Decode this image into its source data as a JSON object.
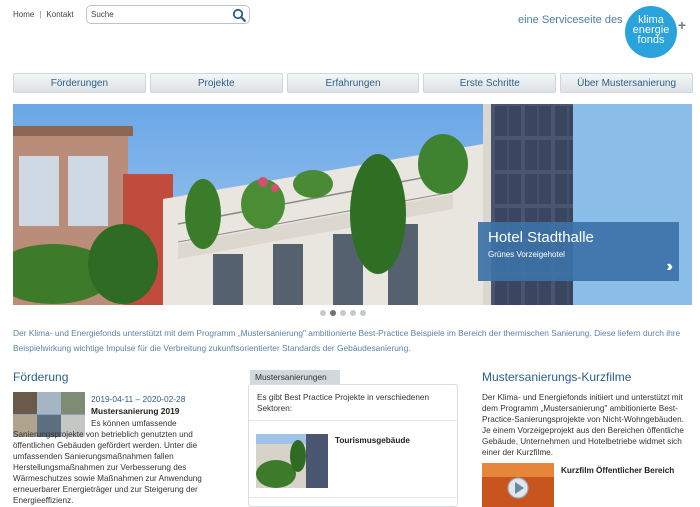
{
  "header": {
    "links": {
      "home": "Home",
      "separator": "|",
      "kontakt": "Kontakt"
    },
    "search": {
      "placeholder": "Suche"
    },
    "service_text": "eine Serviceseite des",
    "logo": {
      "line1": "klima",
      "line2": "energie",
      "line3": "fonds",
      "plus": "+"
    }
  },
  "nav": {
    "items": [
      "Förderungen",
      "Projekte",
      "Erfahrungen",
      "Erste Schritte",
      "Über Mustersanierung"
    ]
  },
  "slider": {
    "title": "Hotel Stadthalle",
    "subtitle": "Grünes Vorzeigehotel",
    "next_arrow": "››",
    "slide_count": 5,
    "active_slide": 2
  },
  "intro": "Der Klima- und Energiefonds unterstützt mit dem Programm „Mustersanierung\" ambitionierte Best-Practice Beispiele im Bereich der thermischen Sanierung. Diese liefern durch ihre Beispielwirkung wichtige Impulse für die Verbreitung zukunftsorientierter Standards der Gebäudesanierung.",
  "foerderung": {
    "heading": "Förderung",
    "date": "2019-04-11 – 2020-02-28",
    "title": "Mustersanierung 2019",
    "text": "Es können umfassende Sanierungsprojekte von betrieblich genutzten und öffentlichen Gebäuden gefördert werden. Unter die umfassenden Sanierungsmaßnahmen fallen Herstellungsmaßnahmen zur Verbesserung des Wärmeschutzes sowie Maßnahmen zur Anwendung erneuerbarer Energieträger und zur Steigerung der Energieeffizienz."
  },
  "mustersanierungen": {
    "tab": "Mustersanierungen",
    "intro": "Es gibt Best Practice Projekte in verschiedenen Sektoren:",
    "items": [
      {
        "label": "Tourismusgebäude"
      }
    ]
  },
  "kurzfilme": {
    "heading": "Mustersanierungs-Kurzfilme",
    "text": "Der Klima- und Energiefonds initiiert und unterstützt mit dem Programm „Mustersanierung\" ambitionierte Best-Practice-Sanierungsprojekte von Nicht-Wohngebäuden. Je einem Vorzeigeprojekt aus den Bereichen öffentliche Gebäude, Unternehmen und Hotelbetriebe widmet sich einer der Kurzfilme.",
    "items": [
      {
        "label": "Kurzfilm Öffentlicher Bereich"
      }
    ]
  },
  "colors": {
    "accent": "#2c5f8a",
    "intro_text": "#5e82a6",
    "logo": "#2aa3dc",
    "slider_box": "#3d72a8"
  }
}
